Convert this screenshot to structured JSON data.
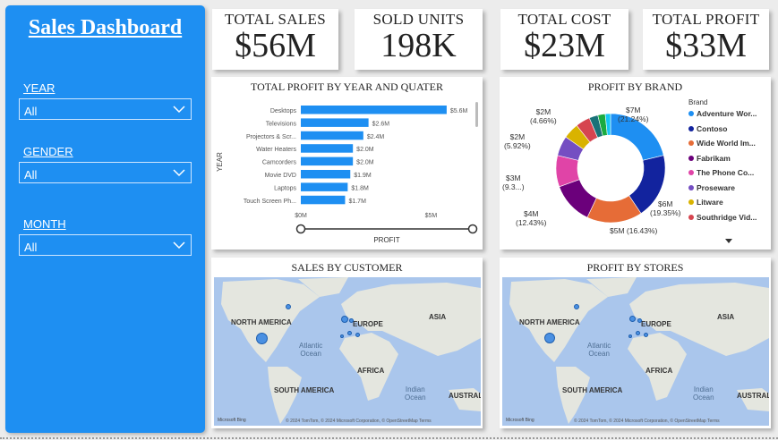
{
  "sidebar": {
    "title": "Sales Dashboard",
    "filters": [
      {
        "label": "YEAR",
        "value": "All"
      },
      {
        "label": "GENDER",
        "value": "All"
      },
      {
        "label": "MONTH",
        "value": "All"
      }
    ]
  },
  "kpis": [
    {
      "label": "TOTAL SALES",
      "value": "$56M"
    },
    {
      "label": "SOLD UNITS",
      "value": "198K"
    },
    {
      "label": "TOTAL COST",
      "value": "$23M"
    },
    {
      "label": "TOTAL PROFIT",
      "value": "$33M"
    }
  ],
  "colors": {
    "sidebar": "#1e8ff2",
    "bar": "#1e8ff2"
  },
  "chart_data": [
    {
      "type": "bar",
      "title": "TOTAL PROFIT BY YEAR AND QUATER",
      "ylabel": "YEAR",
      "xlabel": "PROFIT",
      "categories": [
        "Desktops",
        "Televisions",
        "Projectors & Scr...",
        "Water Heaters",
        "Camcorders",
        "Movie DVD",
        "Laptops",
        "Touch Screen Ph..."
      ],
      "values": [
        5.6,
        2.6,
        2.4,
        2.0,
        2.0,
        1.9,
        1.8,
        1.7
      ],
      "data_labels": [
        "$5.6M",
        "$2.6M",
        "$2.4M",
        "$2.0M",
        "$2.0M",
        "$1.9M",
        "$1.8M",
        "$1.7M"
      ],
      "x_ticks": [
        "$0M",
        "$5M"
      ],
      "xlim": [
        0,
        6.6
      ]
    },
    {
      "type": "pie",
      "title": "PROFIT BY BRAND",
      "legend_title": "Brand",
      "legend": [
        {
          "name": "Adventure Wor...",
          "color": "#1e8ff2"
        },
        {
          "name": "Contoso",
          "color": "#12239e"
        },
        {
          "name": "Wide World Im...",
          "color": "#e66c37"
        },
        {
          "name": "Fabrikam",
          "color": "#6b007b"
        },
        {
          "name": "The Phone Co...",
          "color": "#e044a7"
        },
        {
          "name": "Proseware",
          "color": "#744ec2"
        },
        {
          "name": "Litware",
          "color": "#d9b300"
        },
        {
          "name": "Southridge Vid...",
          "color": "#d64550"
        }
      ],
      "slices": [
        {
          "value": 21.24,
          "color": "#1e8ff2",
          "label": "$7M",
          "pct": "(21.24%)"
        },
        {
          "value": 19.35,
          "color": "#12239e",
          "label": "$6M",
          "pct": "(19.35%)"
        },
        {
          "value": 16.43,
          "color": "#e66c37",
          "label": "$5M (16.43%)",
          "pct": ""
        },
        {
          "value": 12.43,
          "color": "#6b007b",
          "label": "$4M",
          "pct": "(12.43%)"
        },
        {
          "value": 9.3,
          "color": "#e044a7",
          "label": "$3M",
          "pct": "(9.3...)"
        },
        {
          "value": 5.92,
          "color": "#744ec2",
          "label": "$2M",
          "pct": "(5.92%)"
        },
        {
          "value": 4.66,
          "color": "#d9b300",
          "label": "$2M",
          "pct": "(4.66%)"
        },
        {
          "value": 4.3,
          "color": "#d64550",
          "label": "",
          "pct": ""
        },
        {
          "value": 2.6,
          "color": "#197278",
          "label": "",
          "pct": ""
        },
        {
          "value": 2.2,
          "color": "#1aab40",
          "label": "",
          "pct": ""
        },
        {
          "value": 1.57,
          "color": "#15c6f4",
          "label": "",
          "pct": ""
        }
      ]
    }
  ],
  "maps": [
    {
      "title": "SALES BY CUSTOMER",
      "labels": [
        "NORTH AMERICA",
        "EUROPE",
        "ASIA",
        "AFRICA",
        "SOUTH AMERICA",
        "AUSTRAL"
      ],
      "oceans": [
        "Atlantic\nOcean",
        "Indian\nOcean"
      ],
      "attribution": "© 2024 TomTom, © 2024 Microsoft Corporation, © OpenStreetMap  Terms",
      "bing": "Microsoft Bing"
    },
    {
      "title": "PROFIT BY STORES",
      "labels": [
        "NORTH AMERICA",
        "EUROPE",
        "ASIA",
        "AFRICA",
        "SOUTH AMERICA",
        "AUSTRAL"
      ],
      "oceans": [
        "Atlantic\nOcean",
        "Indian\nOcean"
      ],
      "attribution": "© 2024 TomTom, © 2024 Microsoft Corporation, © OpenStreetMap  Terms",
      "bing": "Microsoft Bing"
    }
  ]
}
